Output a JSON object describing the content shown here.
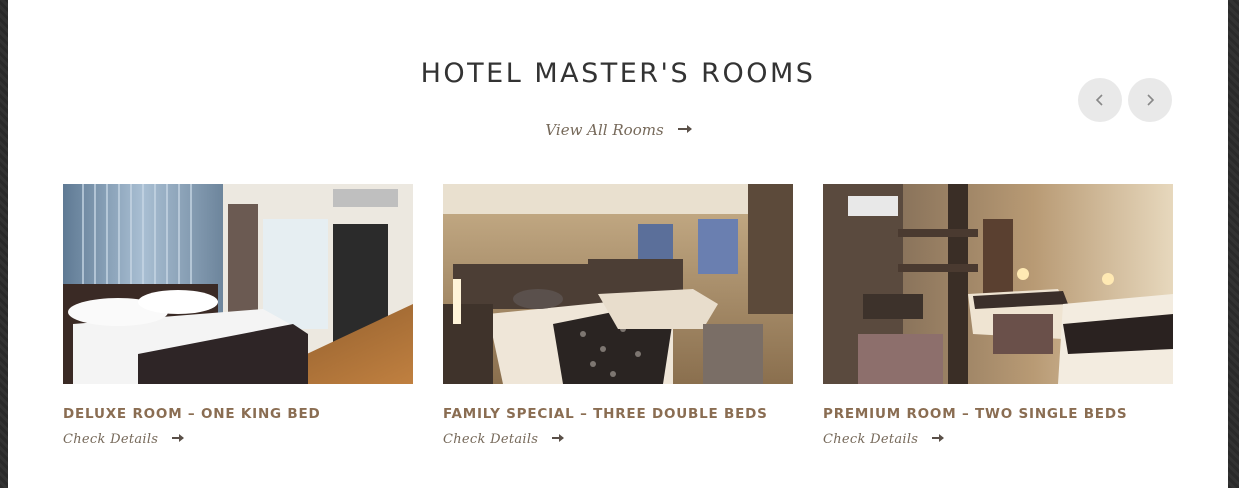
{
  "section": {
    "title": "HOTEL MASTER'S ROOMS",
    "view_all_label": "View All Rooms"
  },
  "carousel": {
    "prev_icon": "chevron-left-icon",
    "next_icon": "chevron-right-icon"
  },
  "rooms": [
    {
      "title": "DELUXE ROOM – ONE KING BED",
      "link_label": "Check Details"
    },
    {
      "title": "FAMILY SPECIAL – THREE DOUBLE BEDS",
      "link_label": "Check Details"
    },
    {
      "title": "PREMIUM ROOM – TWO SINGLE BEDS",
      "link_label": "Check Details"
    }
  ],
  "colors": {
    "accent": "#8a6d52",
    "link": "#76695a",
    "nav_button": "#e9e9e9",
    "background_frame": "#2e2e2e"
  }
}
